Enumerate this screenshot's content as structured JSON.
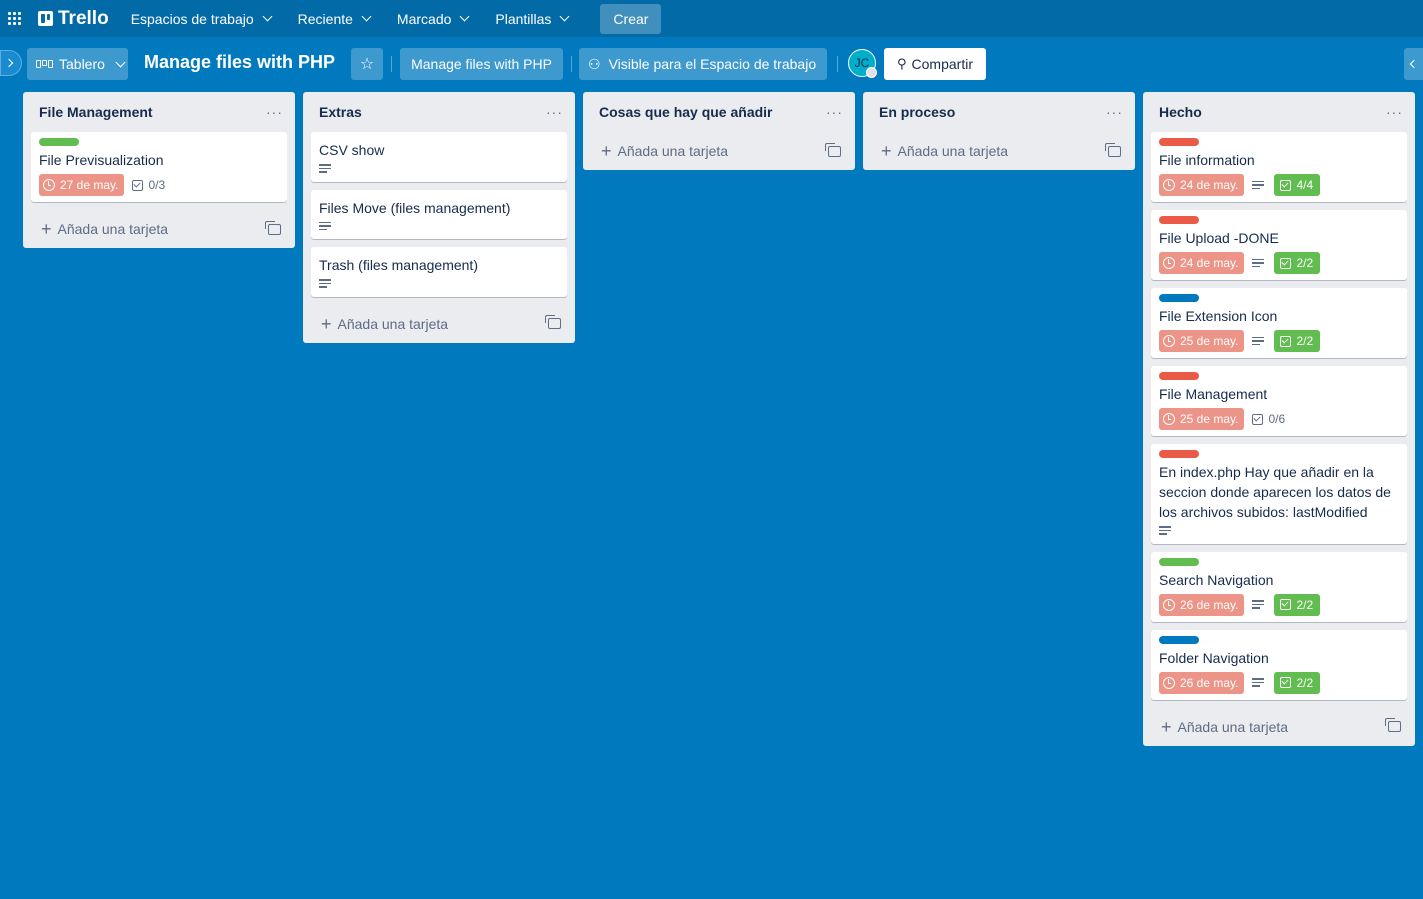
{
  "topbar": {
    "logo": "Trello",
    "nav": [
      "Espacios de trabajo",
      "Reciente",
      "Marcado",
      "Plantillas"
    ],
    "create": "Crear"
  },
  "board": {
    "view": "Tablero",
    "title": "Manage files with PHP",
    "workspace": "Manage files with PHP",
    "visibility": "Visible para el Espacio de trabajo",
    "avatar": "JC",
    "share": "Compartir"
  },
  "add_card_label": "Añada una tarjeta",
  "lists": [
    {
      "title": "File Management",
      "cards": [
        {
          "label": "#61bd4f",
          "title": "File Previsualization",
          "due": "27 de may.",
          "desc": false,
          "checklist": "0/3",
          "done": false
        }
      ]
    },
    {
      "title": "Extras",
      "cards": [
        {
          "title": "CSV show",
          "desc": true
        },
        {
          "title": "Files Move (files management)",
          "desc": true
        },
        {
          "title": "Trash (files management)",
          "desc": true
        }
      ]
    },
    {
      "title": "Cosas que hay que añadir",
      "cards": []
    },
    {
      "title": "En proceso",
      "cards": []
    },
    {
      "title": "Hecho",
      "cards": [
        {
          "label": "#eb5a46",
          "title": "File information",
          "due": "24 de may.",
          "desc": true,
          "checklist": "4/4",
          "done": true
        },
        {
          "label": "#eb5a46",
          "title": "File Upload -DONE",
          "due": "24 de may.",
          "desc": true,
          "checklist": "2/2",
          "done": true
        },
        {
          "label": "#0079bf",
          "title": "File Extension Icon",
          "due": "25 de may.",
          "desc": true,
          "checklist": "2/2",
          "done": true
        },
        {
          "label": "#eb5a46",
          "title": "File Management",
          "due": "25 de may.",
          "desc": false,
          "checklist": "0/6",
          "done": false
        },
        {
          "label": "#eb5a46",
          "title": "En index.php Hay que añadir en la seccion donde aparecen los datos de los archivos subidos: lastModified",
          "desc": true
        },
        {
          "label": "#61bd4f",
          "title": "Search Navigation",
          "due": "26 de may.",
          "desc": true,
          "checklist": "2/2",
          "done": true
        },
        {
          "label": "#0079bf",
          "title": "Folder Navigation",
          "due": "26 de may.",
          "desc": true,
          "checklist": "2/2",
          "done": true
        }
      ]
    }
  ]
}
